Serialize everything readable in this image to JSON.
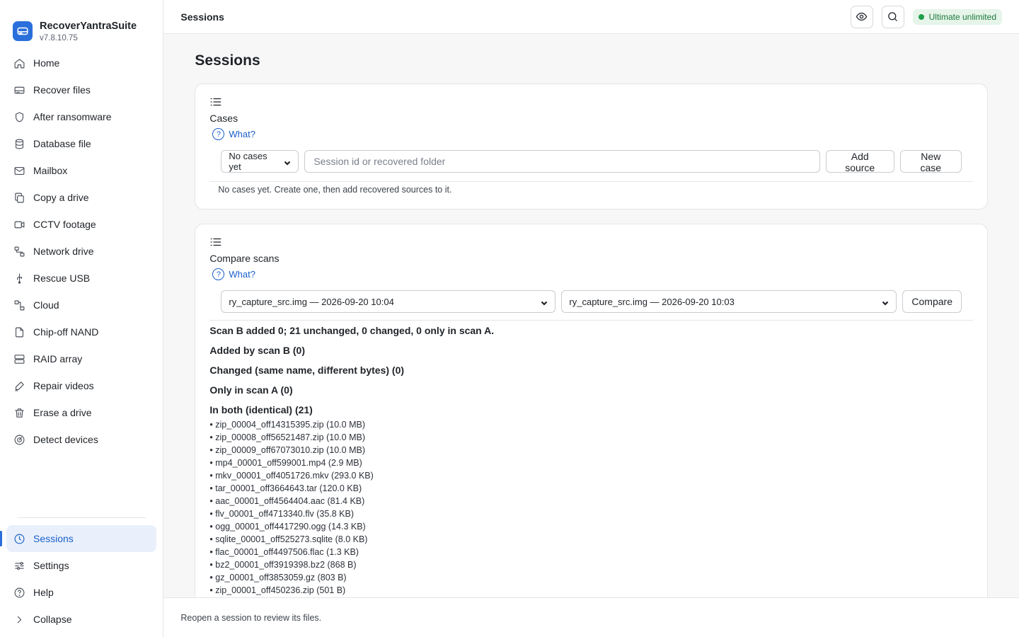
{
  "app": {
    "name": "RecoverYantraSuite",
    "version": "v7.8.10.75"
  },
  "nav": {
    "items": [
      {
        "label": "Home",
        "icon": "home-icon"
      },
      {
        "label": "Recover files",
        "icon": "drive-icon"
      },
      {
        "label": "After ransomware",
        "icon": "shield-icon"
      },
      {
        "label": "Database file",
        "icon": "database-icon"
      },
      {
        "label": "Mailbox",
        "icon": "mail-icon"
      },
      {
        "label": "Copy a drive",
        "icon": "copy-icon"
      },
      {
        "label": "CCTV footage",
        "icon": "video-icon"
      },
      {
        "label": "Network drive",
        "icon": "network-icon"
      },
      {
        "label": "Rescue USB",
        "icon": "usb-icon"
      },
      {
        "label": "Cloud",
        "icon": "cloud-icon"
      },
      {
        "label": "Chip-off NAND",
        "icon": "file-icon"
      },
      {
        "label": "RAID array",
        "icon": "raid-icon"
      },
      {
        "label": "Repair videos",
        "icon": "pen-icon"
      },
      {
        "label": "Erase a drive",
        "icon": "trash-icon"
      },
      {
        "label": "Detect devices",
        "icon": "detect-icon"
      }
    ],
    "bottom": [
      {
        "label": "Sessions",
        "icon": "clock-icon",
        "active": true
      },
      {
        "label": "Settings",
        "icon": "sliders-icon"
      },
      {
        "label": "Help",
        "icon": "help-icon"
      },
      {
        "label": "Collapse",
        "icon": "chevron-right-icon"
      }
    ]
  },
  "topbar": {
    "title": "Sessions",
    "plan": "Ultimate unlimited"
  },
  "page": {
    "title": "Sessions"
  },
  "cases": {
    "title": "Cases",
    "what": "What?",
    "select_value": "No cases yet",
    "input_placeholder": "Session id or recovered folder",
    "add_source": "Add source",
    "new_case": "New case",
    "hint": "No cases yet. Create one, then add recovered sources to it."
  },
  "compare": {
    "title": "Compare scans",
    "what": "What?",
    "scan_a": "ry_capture_src.img — 2026-09-20 10:04",
    "scan_b": "ry_capture_src.img — 2026-09-20 10:03",
    "compare_btn": "Compare",
    "summary": "Scan B added 0; 21 unchanged, 0 changed, 0 only in scan A.",
    "added": "Added by scan B (0)",
    "changed": "Changed (same name, different bytes) (0)",
    "only_a": "Only in scan A (0)",
    "both": "In both (identical) (21)",
    "files": [
      "• zip_00004_off14315395.zip (10.0 MB)",
      "• zip_00008_off56521487.zip (10.0 MB)",
      "• zip_00009_off67073010.zip (10.0 MB)",
      "• mp4_00001_off599001.mp4 (2.9 MB)",
      "• mkv_00001_off4051726.mkv (293.0 KB)",
      "• tar_00001_off3664643.tar (120.0 KB)",
      "• aac_00001_off4564404.aac (81.4 KB)",
      "• flv_00001_off4713340.flv (35.8 KB)",
      "• ogg_00001_off4417290.ogg (14.3 KB)",
      "• sqlite_00001_off525273.sqlite (8.0 KB)",
      "• flac_00001_off4497506.flac (1.3 KB)",
      "• bz2_00001_off3919398.bz2 (868 B)",
      "• gz_00001_off3853059.gz (803 B)",
      "• zip_00001_off450236.zip (501 B)"
    ]
  },
  "status": {
    "text": "Reopen a session to review its files."
  },
  "colors": {
    "accent": "#2a6fdb",
    "plan_bg": "#e6f4ea",
    "plan_text": "#1e7a3a"
  }
}
